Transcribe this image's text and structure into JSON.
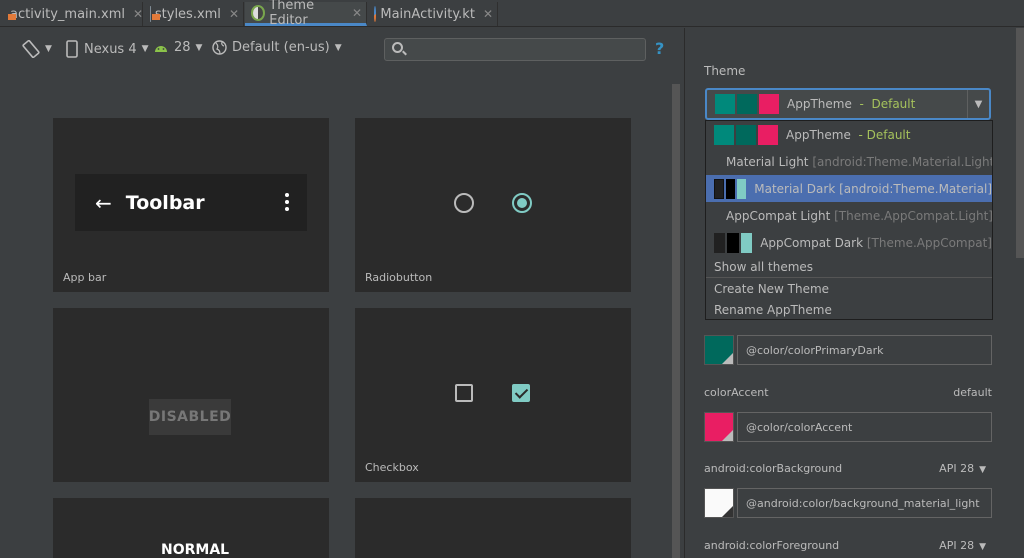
{
  "tabs": [
    {
      "label": "activity_main.xml",
      "icon": "xml-layout-icon"
    },
    {
      "label": "styles.xml",
      "icon": "xml-layout-icon"
    },
    {
      "label": "Theme Editor",
      "icon": "theme-editor-icon",
      "active": true
    },
    {
      "label": "MainActivity.kt",
      "icon": "kotlin-file-icon"
    }
  ],
  "toolbar": {
    "device": "Nexus 4",
    "api": "28",
    "locale": "Default (en-us)",
    "search_placeholder": "",
    "help": "?"
  },
  "preview": {
    "appbar": {
      "title": "Toolbar",
      "label": "App bar"
    },
    "radiobutton": {
      "label": "Radiobutton"
    },
    "disabled": {
      "text": "DISABLED"
    },
    "checkbox": {
      "label": "Checkbox"
    },
    "normal": {
      "text": "NORMAL"
    }
  },
  "theme": {
    "label": "Theme",
    "selected": {
      "name": "AppTheme",
      "sep": "-",
      "tag": "Default",
      "colors": [
        "#00897b",
        "#00695c",
        "#e91e63"
      ]
    },
    "options": [
      {
        "name": "AppTheme",
        "suffix": "-  Default",
        "colors": [
          "#00897b",
          "#00695c",
          "#e91e63"
        ]
      },
      {
        "name": "Material Light",
        "suffix": "[android:Theme.Material.Light]",
        "colors": [
          "#f5f5f5",
          "#757575",
          "#009688"
        ]
      },
      {
        "name": "Material Dark",
        "suffix": "[android:Theme.Material]",
        "colors": [
          "#212121",
          "#000000",
          "#80cbc4"
        ],
        "highlighted": true
      },
      {
        "name": "AppCompat Light",
        "suffix": "[Theme.AppCompat.Light]",
        "colors": [
          "#f5f5f5",
          "#757575",
          "#009688"
        ]
      },
      {
        "name": "AppCompat Dark",
        "suffix": "[Theme.AppCompat]",
        "colors": [
          "#212121",
          "#000000",
          "#80cbc4"
        ]
      }
    ],
    "show_all": "Show all themes",
    "create_new": "Create New Theme",
    "rename": "Rename AppTheme"
  },
  "attributes": [
    {
      "name": "",
      "right": "",
      "value": "@color/colorPrimaryDark",
      "color": "#00695c"
    },
    {
      "name": "colorAccent",
      "right": "default",
      "value": "@color/colorAccent",
      "color": "#e91e63"
    },
    {
      "name": "android:colorBackground",
      "right": "API 28",
      "value": "@android:color/background_material_light",
      "color": "#fafafa"
    },
    {
      "name": "android:colorForeground",
      "right": "API 28",
      "value": "",
      "color": ""
    }
  ],
  "colors": {
    "accent": "#4a88c7",
    "selection": "#4b6eaf",
    "teal": "#80cbc4",
    "default_tag": "#a5c25c"
  }
}
